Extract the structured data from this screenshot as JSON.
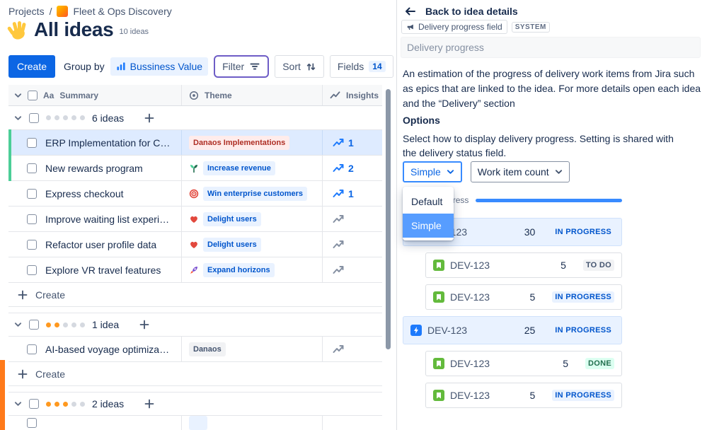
{
  "colors": {
    "accent_blue": "#0C66E4",
    "selected_row": "#DEEBFF",
    "tag_red_bg": "#FFECEB",
    "progress_bar": "#388BFF",
    "focus_ring_purple": "#6E5DC6",
    "green_indicator": "#4BCE97",
    "rating_dot_orange": "#FF991F"
  },
  "breadcrumb": {
    "projects": "Projects",
    "separator": "/",
    "project_name": "Fleet & Ops Discovery"
  },
  "page": {
    "title": "All ideas",
    "idea_count": "10 ideas",
    "title_icon": "waving-hand-icon"
  },
  "toolbar": {
    "create_label": "Create",
    "group_by_label": "Group by",
    "group_by_value": "Bussiness Value",
    "filter_label": "Filter",
    "sort_label": "Sort",
    "fields_label": "Fields",
    "fields_count": "14"
  },
  "table": {
    "header": {
      "summary_icon": "Aa",
      "summary": "Summary",
      "theme": "Theme",
      "insights": "Insights"
    },
    "create_row_label": "Create",
    "groups": [
      {
        "count_label": "6 ideas",
        "rating": 0,
        "rows": [
          {
            "summary": "ERP Implementation for Clie...",
            "theme_label": "Danaos Implementations",
            "theme_style": "red",
            "insights": "1",
            "selected": true
          },
          {
            "summary": "New rewards program",
            "theme_icon": "seedling-icon",
            "theme_label": "Increase revenue",
            "theme_style": "blue",
            "insights": "2"
          },
          {
            "summary": "Express checkout",
            "theme_icon": "target-icon",
            "theme_label": "Win enterprise customers",
            "theme_style": "blue",
            "insights": "1"
          },
          {
            "summary": "Improve waiting list experie...",
            "theme_icon": "heart-icon",
            "theme_label": "Delight users",
            "theme_style": "blue"
          },
          {
            "summary": "Refactor user profile data",
            "theme_icon": "heart-icon",
            "theme_label": "Delight users",
            "theme_style": "blue"
          },
          {
            "summary": "Explore VR travel features",
            "theme_icon": "rocket-icon",
            "theme_label": "Expand horizons",
            "theme_style": "blue"
          }
        ]
      },
      {
        "count_label": "1 idea",
        "rating": 2,
        "rows": [
          {
            "summary": "AI-based voyage optimization",
            "theme_label": "Danaos",
            "theme_style": "gray"
          }
        ]
      },
      {
        "count_label": "2 ideas",
        "rating": 3,
        "rows": []
      }
    ]
  },
  "panel": {
    "back_label": "Back to idea details",
    "field_chip": {
      "label": "Delivery progress field",
      "badge": "SYSTEM"
    },
    "name_placeholder": "Delivery progress",
    "description": "An estimation of the progress of delivery work items from Jira such as epics that are linked to the idea. For more details open each idea and the “Delivery” section",
    "options_title": "Options",
    "options_description": "Select how to display delivery progress. Setting is shared with the delivery status field.",
    "display_mode_value": "Simple",
    "work_item_value": "Work item count",
    "menu": {
      "items": [
        "Default",
        "Simple"
      ],
      "selected": "Simple"
    },
    "preview": {
      "progress_label": "Delivery progress",
      "progress_percent": 100,
      "items": [
        {
          "code": "DEV-123",
          "value": "30",
          "status": "IN PROGRESS",
          "level": 0,
          "highlight": true,
          "icon": "epic-icon"
        },
        {
          "code": "DEV-123",
          "value": "5",
          "status": "TO DO",
          "level": 1,
          "icon": "story-icon"
        },
        {
          "code": "DEV-123",
          "value": "5",
          "status": "IN PROGRESS",
          "level": 1,
          "icon": "story-icon"
        },
        {
          "code": "DEV-123",
          "value": "25",
          "status": "IN PROGRESS",
          "level": 0,
          "highlight": true,
          "icon": "initiative-icon"
        },
        {
          "code": "DEV-123",
          "value": "5",
          "status": "DONE",
          "level": 1,
          "icon": "story-icon"
        },
        {
          "code": "DEV-123",
          "value": "5",
          "status": "IN PROGRESS",
          "level": 1,
          "icon": "story-icon"
        }
      ]
    }
  }
}
